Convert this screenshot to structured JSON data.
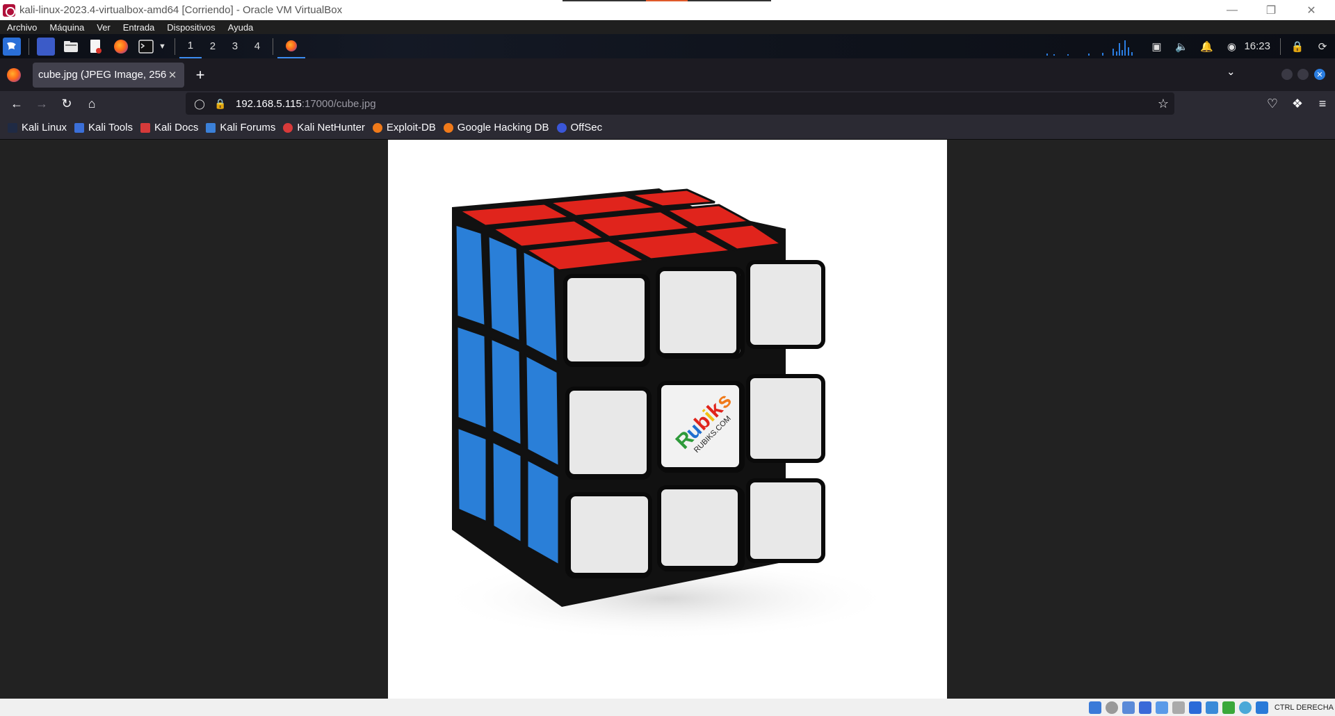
{
  "vbox": {
    "window_title": "kali-linux-2023.4-virtualbox-amd64 [Corriendo] - Oracle VM VirtualBox",
    "menu": [
      "Archivo",
      "Máquina",
      "Ver",
      "Entrada",
      "Dispositivos",
      "Ayuda"
    ],
    "status_host_key": "CTRL DERECHA"
  },
  "panel": {
    "workspaces": [
      "1",
      "2",
      "3",
      "4"
    ],
    "active_workspace": "1",
    "clock": "16:23"
  },
  "browser": {
    "tab_label": "cube.jpg (JPEG Image, 2560",
    "url_host": "192.168.5.115",
    "url_path": ":17000/cube.jpg",
    "bookmarks": [
      {
        "label": "Kali Linux",
        "icon": "kali-dragon-icon",
        "color": "#1f2a44"
      },
      {
        "label": "Kali Tools",
        "icon": "kali-tools-icon",
        "color": "#3b6fd8"
      },
      {
        "label": "Kali Docs",
        "icon": "kali-docs-icon",
        "color": "#d63a3a"
      },
      {
        "label": "Kali Forums",
        "icon": "kali-forums-icon",
        "color": "#3b80d8"
      },
      {
        "label": "Kali NetHunter",
        "icon": "nethunter-icon",
        "color": "#d83a3a"
      },
      {
        "label": "Exploit-DB",
        "icon": "exploitdb-icon",
        "color": "#f07a1a"
      },
      {
        "label": "Google Hacking DB",
        "icon": "ghdb-icon",
        "color": "#f07a1a"
      },
      {
        "label": "OffSec",
        "icon": "offsec-icon",
        "color": "#3a56d8"
      }
    ]
  },
  "image": {
    "logo_text": "Rubiks",
    "logo_sub": "RUBIKS.COM"
  }
}
